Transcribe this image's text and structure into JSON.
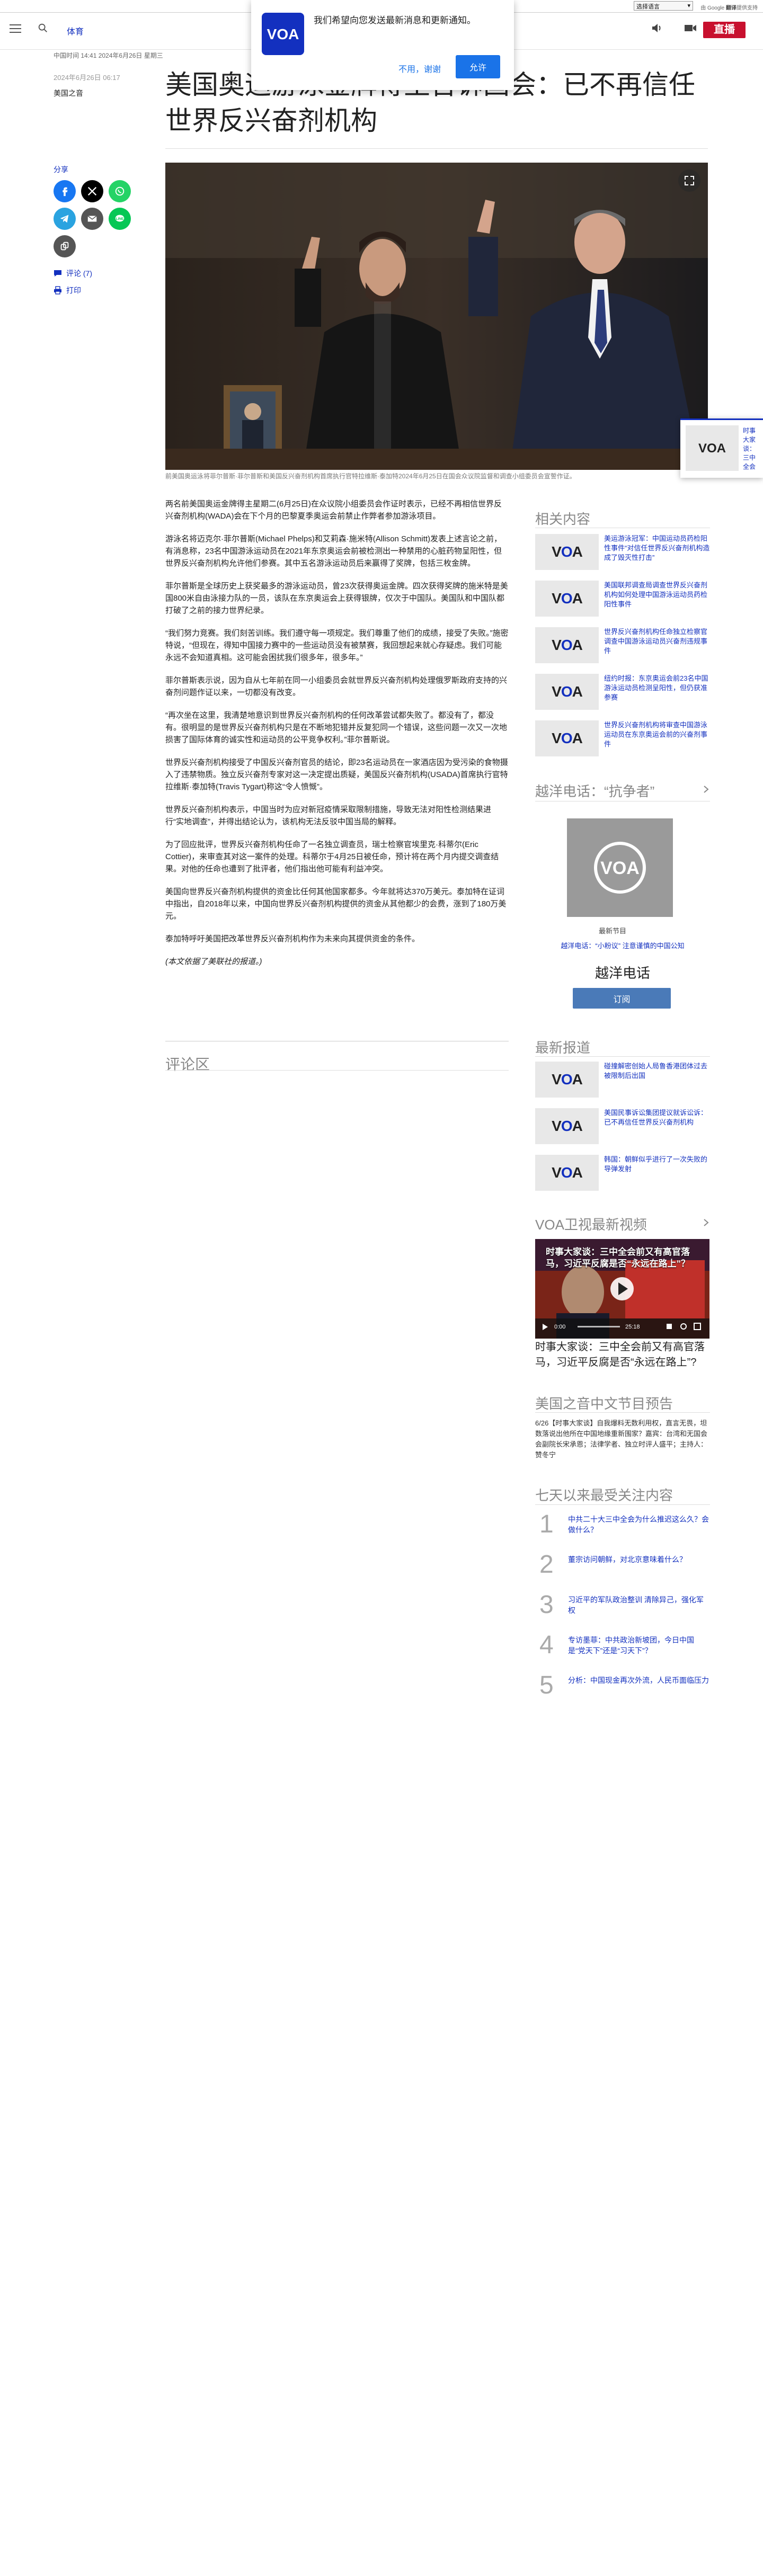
{
  "translate": {
    "select_label": "选择语言",
    "powered_by": "由 Google",
    "translate_word": "翻译",
    "provided": "提供支持"
  },
  "header": {
    "section": "体育",
    "live_label": "直播",
    "icons": [
      "hamburger-icon",
      "search-icon",
      "speaker-icon",
      "video-icon"
    ]
  },
  "notification": {
    "text": "我们希望向您发送最新消息和更新通知。",
    "decline": "不用，谢谢",
    "accept": "允许"
  },
  "article": {
    "meta_date": "中国时间 14:41 2024年6月26日 星期三",
    "pub_date": "2024年6月26日 06:17",
    "author": "美国之音",
    "title": "美国奥运游泳金牌得主告诉国会：已不再信任世界反兴奋剂机构",
    "share_label": "分享",
    "comments_link": "评论 (7)",
    "print_link": "打印",
    "caption": "前美国奥运泳将菲尔普斯·菲尔普斯和美国反兴奋剂机构首席执行官特拉维斯·泰加特2024年6月25日在国会众议院监督和调查小组委员会宣誓作证。",
    "paragraphs": [
      "两名前美国奥运金牌得主星期二(6月25日)在众议院小组委员会作证时表示，已经不再相信世界反兴奋剂机构(WADA)会在下个月的巴黎夏季奥运会前禁止作弊者参加游泳项目。",
      "游泳名将迈克尔·菲尔普斯(Michael Phelps)和艾莉森·施米特(Allison Schmitt)发表上述言论之前，有消息称，23名中国游泳运动员在2021年东京奥运会前被检测出一种禁用的心脏药物呈阳性，但世界反兴奋剂机构允许他们参赛。其中五名游泳运动员后来赢得了奖牌，包括三枚金牌。",
      "菲尔普斯是全球历史上获奖最多的游泳运动员，曾23次获得奥运金牌。四次获得奖牌的施米特是美国800米自由泳接力队的一员，该队在东京奥运会上获得银牌，仅次于中国队。美国队和中国队都打破了之前的接力世界纪录。",
      "“我们努力竞赛。我们刻苦训练。我们遵守每一项规定。我们尊重了他们的成绩，接受了失败。”施密特说，“但现在，得知中国接力赛中的一些运动员没有被禁赛，我回想起来就心存疑虑。我们可能永远不会知道真相。这可能会困扰我们很多年，很多年。”",
      "菲尔普斯表示说，因为自从七年前在同一小组委员会就世界反兴奋剂机构处理俄罗斯政府支持的兴奋剂问题作证以来，一切都没有改变。",
      "“再次坐在这里，我清楚地意识到世界反兴奋剂机构的任何改革尝试都失败了。都没有了，都没有。很明显的是世界反兴奋剂机构只是在不断地犯错并反复犯同一个错误，这些问题一次又一次地损害了国际体育的诚实性和运动员的公平竞争权利。”菲尔普斯说。",
      "世界反兴奋剂机构接受了中国反兴奋剂官员的结论，即23名运动员在一家酒店因为受污染的食物摄入了违禁物质。独立反兴奋剂专家对这一决定提出质疑，美国反兴奋剂机构(USADA)首席执行官特拉维斯·泰加特(Travis Tygart)称这“令人愤慨”。",
      "世界反兴奋剂机构表示，中国当时为应对新冠疫情采取限制措施，导致无法对阳性检测结果进行“实地调查”，并得出结论认为，该机构无法反驳中国当局的解释。",
      "为了回应批评，世界反兴奋剂机构任命了一名独立调查员，瑞士检察官埃里克·科蒂尔(Eric Cottier)，来审查其对这一案件的处理。科蒂尔于4月25日被任命，预计将在两个月内提交调查结果。对他的任命也遭到了批评者，他们指出他可能有利益冲突。",
      "美国向世界反兴奋剂机构提供的资金比任何其他国家都多。今年就将达370万美元。泰加特在证词中指出，自2018年以来，中国向世界反兴奋剂机构提供的资金从其他都少的会费，涨到了180万美元。",
      "泰加特呼吁美国把改革世界反兴奋剂机构作为未来向其提供资金的条件。",
      "(本文依据了美联社的报道。)"
    ],
    "comments_heading": "评论区"
  },
  "sidebar": {
    "related_title": "相关内容",
    "related": [
      "美运游泳冠军：中国运动员药检阳性事件“对信任世界反兴奋剂机构造成了毁灭性打击”",
      "美国联邦调查局调查世界反兴奋剂机构如何处理中国游泳运动员药检阳性事件",
      "世界反兴奋剂机构任命独立检察官调查中国游泳运动员兴奋剂违规事件",
      "纽约时报：东京奥运会前23名中国游泳运动员检测呈阳性，但仍获准参赛",
      "世界反兴奋剂机构将审查中国游泳运动员在东京奥运会前的兴奋剂事件"
    ],
    "podcast_title": "越洋电话：“抗争者”",
    "podcast_label": "最新节目",
    "podcast_episode": "越洋电话：“小粉议” 注意谨慎的中国公知",
    "podcast_name": "越洋电话",
    "subscribe_label": "订阅",
    "latest_title": "最新报道",
    "latest": [
      "碰撞解密创始人局鲁香港团体过去被限制后出国",
      "美国民事诉讼集团提议就诉讼诉：已不再信任世界反兴奋剂机构",
      "韩国：朝鲜似乎进行了一次失败的导弹发射"
    ],
    "video_section_title": "VOA卫视最新视频",
    "video_overlay": "时事大家谈：三中全会前又有高官落马，习近平反腐是否“永远在路上”？",
    "video_title": "时事大家谈：三中全会前又有高官落马，习近平反腐是否“永远在路上”?",
    "video_time_current": "0:00",
    "video_time_total": "25:18",
    "preview_title": "美国之音中文节目预告",
    "preview_desc": "6/26【时事大家谈】自我爆料无数利用权，直言无畏，坦数落说出他所在中国地缘重新围家？嘉宾：台湾和无国会会副院长宋承恩；法律学者、独立时评人盛平；主持人：赞冬宁",
    "popular_title": "七天以来最受关注内容",
    "popular": [
      "中共二十大三中全会为什么推迟这么久？会做什么？",
      "董宗访问朝鲜，对北京意味着什么？",
      "习近平的军队政治整训 清除异己，强化军权",
      "专访墨菲：中共政治新坡团，今日中国是“党天下”还是“习天下”？",
      "分析：中国现金再次外流，人民币面临压力"
    ]
  },
  "float_card": {
    "text": "时事大家谈：三中全会前又有高官落马，习近平反腐是否"
  },
  "colors": {
    "brand_blue": "#1330bf",
    "live_red": "#c8102e",
    "allow_blue": "#1a73e8",
    "facebook": "#1877f2",
    "x": "#000000",
    "whatsapp": "#25d366",
    "telegram": "#2aa3e0",
    "email": "#555555",
    "line": "#06c755",
    "link": "#555555"
  }
}
